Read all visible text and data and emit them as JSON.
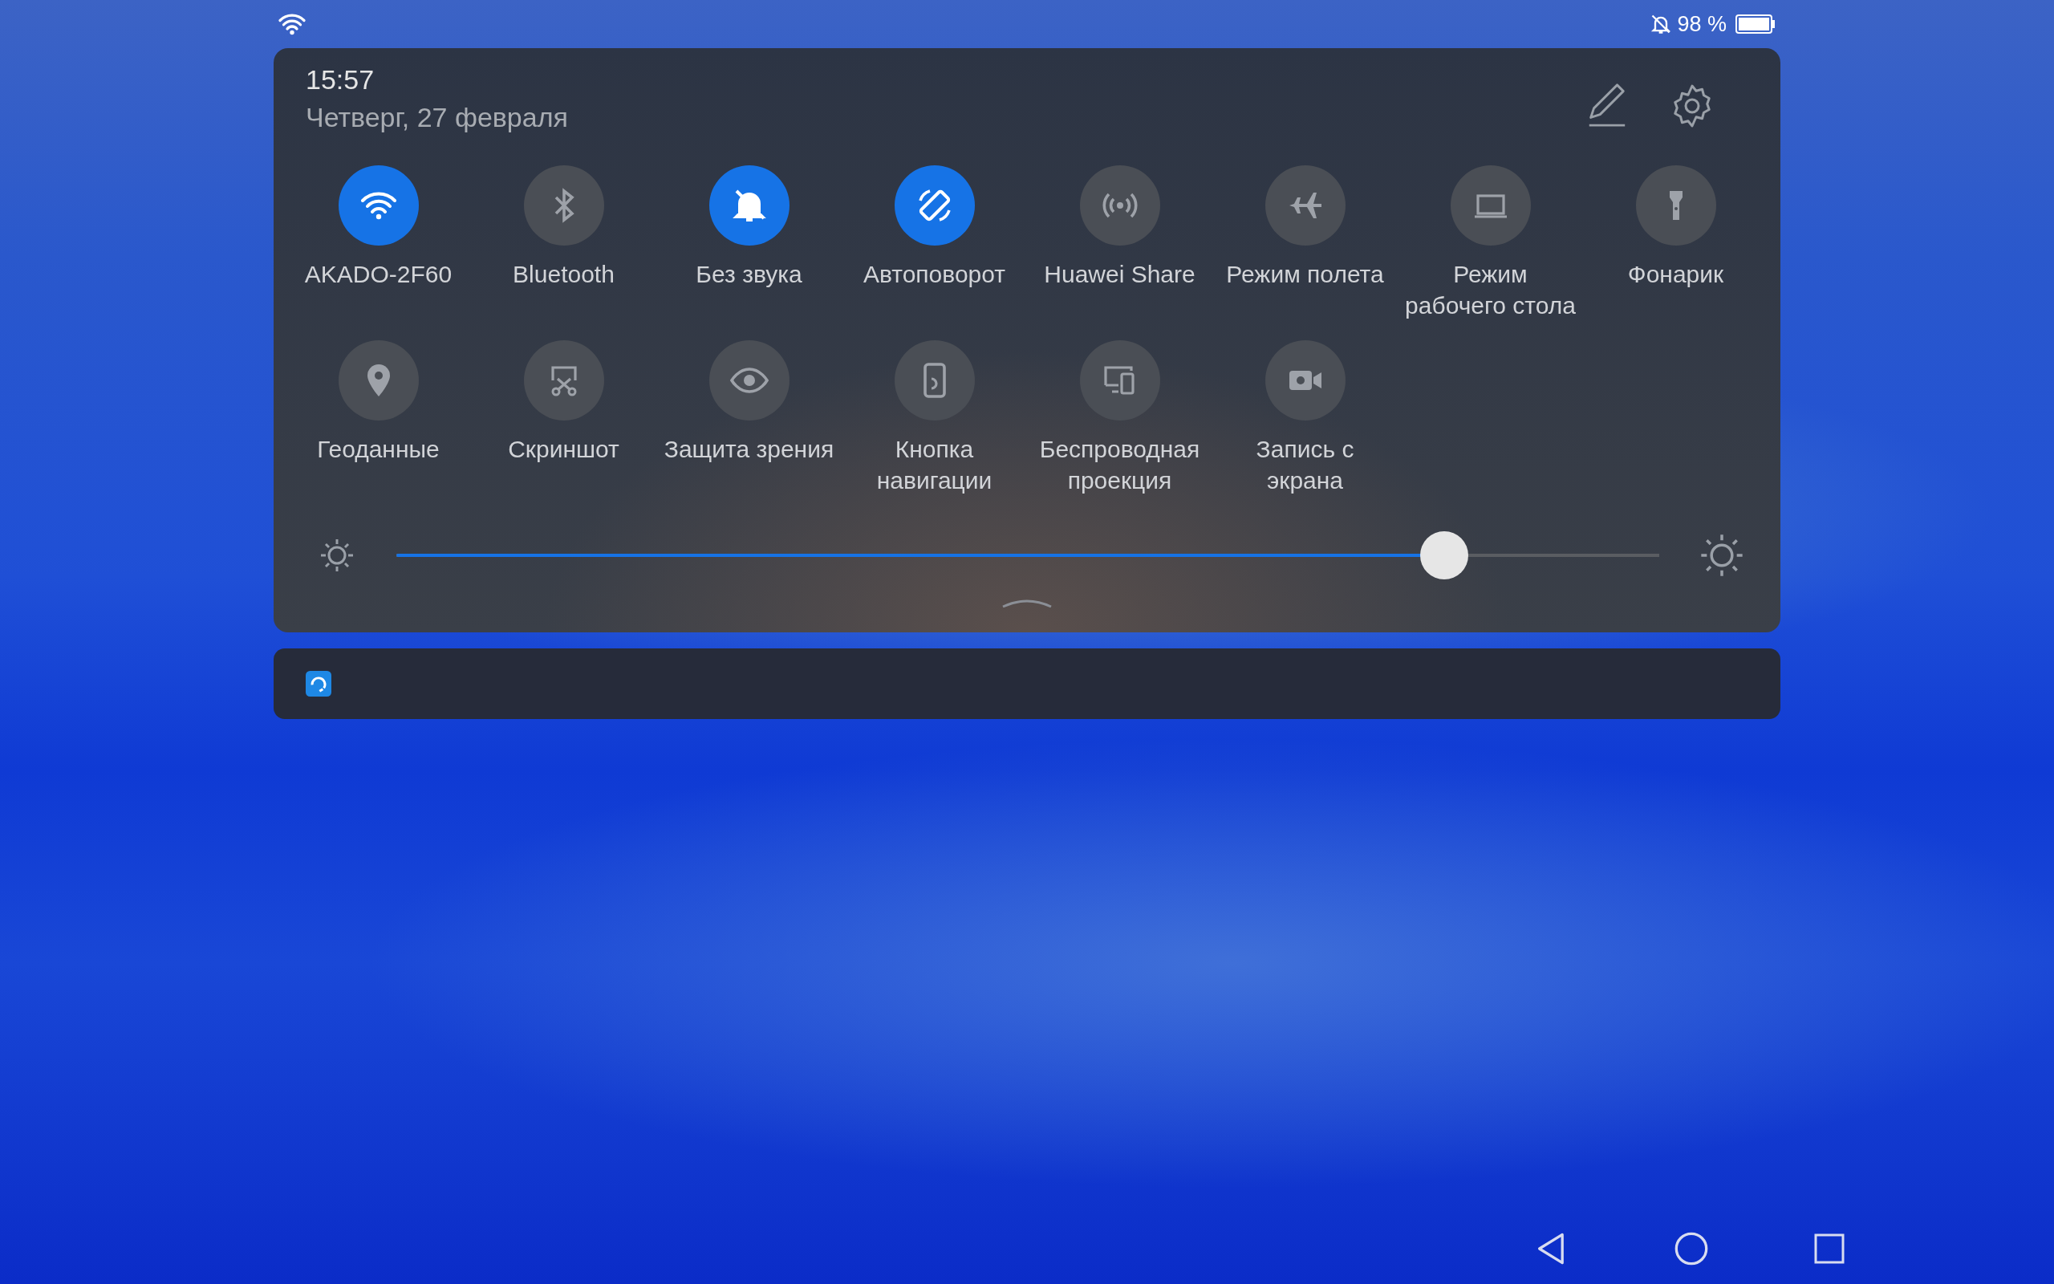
{
  "status_bar": {
    "battery": "98 %"
  },
  "panel": {
    "time": "15:57",
    "date": "Четверг, 27 февраля",
    "tiles": [
      {
        "kind": "wifi",
        "label": "AKADO-2F60",
        "on": true
      },
      {
        "kind": "bluetooth",
        "label": "Bluetooth",
        "on": false
      },
      {
        "kind": "silent",
        "label": "Без звука",
        "on": true
      },
      {
        "kind": "rotate",
        "label": "Автоповорот",
        "on": true
      },
      {
        "kind": "share",
        "label": "Huawei Share",
        "on": false
      },
      {
        "kind": "airplane",
        "label": "Режим полета",
        "on": false
      },
      {
        "kind": "desktop",
        "label": "Режим рабочего стола",
        "on": false
      },
      {
        "kind": "torch",
        "label": "Фонарик",
        "on": false
      },
      {
        "kind": "location",
        "label": "Геоданные",
        "on": false
      },
      {
        "kind": "screenshot",
        "label": "Скриншот",
        "on": false
      },
      {
        "kind": "eye",
        "label": "Защита зрения",
        "on": false
      },
      {
        "kind": "navkey",
        "label": "Кнопка навигации",
        "on": false
      },
      {
        "kind": "projection",
        "label": "Беспроводная проекция",
        "on": false
      },
      {
        "kind": "record",
        "label": "Запись с экрана",
        "on": false
      }
    ],
    "brightness": {
      "level": 0.83
    }
  }
}
